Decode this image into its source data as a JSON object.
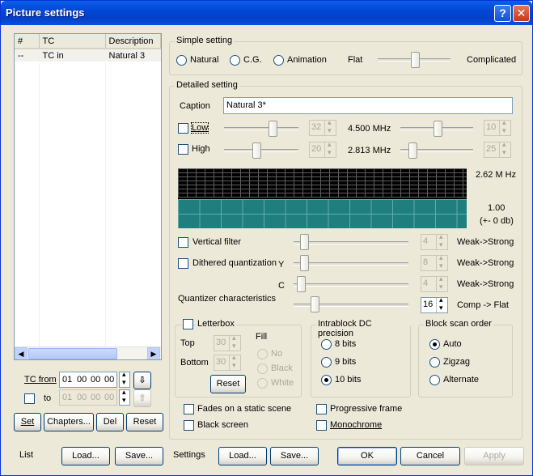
{
  "window": {
    "title": "Picture settings",
    "help_btn": "?",
    "close_btn": "✕"
  },
  "list": {
    "headers": [
      "#",
      "TC",
      "Description"
    ],
    "rows": [
      {
        "num": "--",
        "tc": "TC in",
        "desc": "Natural 3"
      }
    ]
  },
  "tc": {
    "from_label": "TC from",
    "to_label": "to",
    "from": [
      "01",
      "00",
      "00",
      "00"
    ],
    "to": [
      "01",
      "00",
      "00",
      "00"
    ]
  },
  "list_buttons": {
    "set": "Set",
    "chapters": "Chapters...",
    "del": "Del",
    "reset": "Reset"
  },
  "bottom": {
    "list_label": "List",
    "list_load": "Load...",
    "list_save": "Save...",
    "settings_label": "Settings",
    "settings_load": "Load...",
    "settings_save": "Save...",
    "ok": "OK",
    "cancel": "Cancel",
    "apply": "Apply"
  },
  "simple": {
    "title": "Simple setting",
    "radios": [
      "Natural",
      "C.G.",
      "Animation"
    ],
    "flat": "Flat",
    "complicated": "Complicated",
    "slider_fraction": 0.5
  },
  "detailed": {
    "title": "Detailed setting",
    "caption_label": "Caption",
    "caption_value": "Natural 3*",
    "low_label": "Low",
    "low_value": "32",
    "low_freq": "4.500 MHz",
    "low_right_value": "10",
    "high_label": "High",
    "high_value": "20",
    "high_freq": "2.813 MHz",
    "high_right_value": "25",
    "meter_freq": "2.62 M Hz",
    "meter_value": "1.00",
    "meter_db": "(+- 0 db)",
    "vertical_filter": "Vertical filter",
    "dithered": "Dithered quantization",
    "y_label": "Y",
    "c_label": "C",
    "vf_value": "4",
    "dq_y_value": "8",
    "dq_c_value": "4",
    "weak_strong": "Weak->Strong",
    "quantizer_label": "Quantizer characteristics",
    "quantizer_value": "16",
    "comp_flat": "Comp -> Flat"
  },
  "letterbox": {
    "title": "Letterbox",
    "top_label": "Top",
    "bottom_label": "Bottom",
    "top_value": "30",
    "bottom_value": "30",
    "fill_label": "Fill",
    "fill_options": [
      "No",
      "Black",
      "White"
    ],
    "reset": "Reset"
  },
  "intrablock": {
    "title": "Intrablock DC precision",
    "options": [
      "8 bits",
      "9 bits",
      "10 bits"
    ]
  },
  "scan": {
    "title": "Block scan order",
    "options": [
      "Auto",
      "Zigzag",
      "Alternate"
    ]
  },
  "options": {
    "fades": "Fades on a static scene",
    "black_screen": "Black screen",
    "progressive": "Progressive frame",
    "monochrome": "Monochrome"
  },
  "colors": {
    "title_bar": "#0347d7",
    "meter_teal": "#1f7f7f",
    "face": "#ece9d8"
  }
}
